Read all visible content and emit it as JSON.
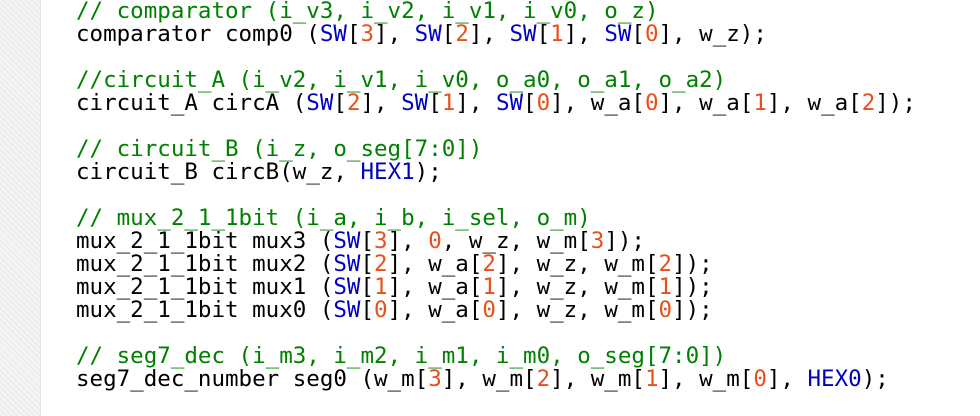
{
  "code_lines": [
    [
      {
        "t": "// comparator (i_v3, i_v2, i_v1, i_v0, o_z)",
        "k": "c"
      }
    ],
    [
      {
        "t": "comparator comp0 (",
        "k": "d"
      },
      {
        "t": "SW",
        "k": "sw"
      },
      {
        "t": "[",
        "k": "d"
      },
      {
        "t": "3",
        "k": "n"
      },
      {
        "t": "], ",
        "k": "d"
      },
      {
        "t": "SW",
        "k": "sw"
      },
      {
        "t": "[",
        "k": "d"
      },
      {
        "t": "2",
        "k": "n"
      },
      {
        "t": "], ",
        "k": "d"
      },
      {
        "t": "SW",
        "k": "sw"
      },
      {
        "t": "[",
        "k": "d"
      },
      {
        "t": "1",
        "k": "n"
      },
      {
        "t": "], ",
        "k": "d"
      },
      {
        "t": "SW",
        "k": "sw"
      },
      {
        "t": "[",
        "k": "d"
      },
      {
        "t": "0",
        "k": "n"
      },
      {
        "t": "], w_z);",
        "k": "d"
      }
    ],
    [],
    [
      {
        "t": "//circuit_A (i_v2, i_v1, i_v0, o_a0, o_a1, o_a2)",
        "k": "c"
      }
    ],
    [
      {
        "t": "circuit_A circA (",
        "k": "d"
      },
      {
        "t": "SW",
        "k": "sw"
      },
      {
        "t": "[",
        "k": "d"
      },
      {
        "t": "2",
        "k": "n"
      },
      {
        "t": "], ",
        "k": "d"
      },
      {
        "t": "SW",
        "k": "sw"
      },
      {
        "t": "[",
        "k": "d"
      },
      {
        "t": "1",
        "k": "n"
      },
      {
        "t": "], ",
        "k": "d"
      },
      {
        "t": "SW",
        "k": "sw"
      },
      {
        "t": "[",
        "k": "d"
      },
      {
        "t": "0",
        "k": "n"
      },
      {
        "t": "], w_a[",
        "k": "d"
      },
      {
        "t": "0",
        "k": "n"
      },
      {
        "t": "], w_a[",
        "k": "d"
      },
      {
        "t": "1",
        "k": "n"
      },
      {
        "t": "], w_a[",
        "k": "d"
      },
      {
        "t": "2",
        "k": "n"
      },
      {
        "t": "]);",
        "k": "d"
      }
    ],
    [],
    [
      {
        "t": "// circuit_B (i_z, o_seg[7:0])",
        "k": "c"
      }
    ],
    [
      {
        "t": "circuit_B circB(w_z, ",
        "k": "d"
      },
      {
        "t": "HEX1",
        "k": "hex"
      },
      {
        "t": ");",
        "k": "d"
      }
    ],
    [],
    [
      {
        "t": "// mux_2_1_1bit (i_a, i_b, i_sel, o_m)",
        "k": "c"
      }
    ],
    [
      {
        "t": "mux_2_1_1bit mux3 (",
        "k": "d"
      },
      {
        "t": "SW",
        "k": "sw"
      },
      {
        "t": "[",
        "k": "d"
      },
      {
        "t": "3",
        "k": "n"
      },
      {
        "t": "], ",
        "k": "d"
      },
      {
        "t": "0",
        "k": "n"
      },
      {
        "t": ", w_z, w_m[",
        "k": "d"
      },
      {
        "t": "3",
        "k": "n"
      },
      {
        "t": "]);",
        "k": "d"
      }
    ],
    [
      {
        "t": "mux_2_1_1bit mux2 (",
        "k": "d"
      },
      {
        "t": "SW",
        "k": "sw"
      },
      {
        "t": "[",
        "k": "d"
      },
      {
        "t": "2",
        "k": "n"
      },
      {
        "t": "], w_a[",
        "k": "d"
      },
      {
        "t": "2",
        "k": "n"
      },
      {
        "t": "], w_z, w_m[",
        "k": "d"
      },
      {
        "t": "2",
        "k": "n"
      },
      {
        "t": "]);",
        "k": "d"
      }
    ],
    [
      {
        "t": "mux_2_1_1bit mux1 (",
        "k": "d"
      },
      {
        "t": "SW",
        "k": "sw"
      },
      {
        "t": "[",
        "k": "d"
      },
      {
        "t": "1",
        "k": "n"
      },
      {
        "t": "], w_a[",
        "k": "d"
      },
      {
        "t": "1",
        "k": "n"
      },
      {
        "t": "], w_z, w_m[",
        "k": "d"
      },
      {
        "t": "1",
        "k": "n"
      },
      {
        "t": "]);",
        "k": "d"
      }
    ],
    [
      {
        "t": "mux_2_1_1bit mux0 (",
        "k": "d"
      },
      {
        "t": "SW",
        "k": "sw"
      },
      {
        "t": "[",
        "k": "d"
      },
      {
        "t": "0",
        "k": "n"
      },
      {
        "t": "], w_a[",
        "k": "d"
      },
      {
        "t": "0",
        "k": "n"
      },
      {
        "t": "], w_z, w_m[",
        "k": "d"
      },
      {
        "t": "0",
        "k": "n"
      },
      {
        "t": "]);",
        "k": "d"
      }
    ],
    [],
    [
      {
        "t": "// seg7_dec (i_m3, i_m2, i_m1, i_m0, o_seg[7:0])",
        "k": "c"
      }
    ],
    [
      {
        "t": "seg7_dec_number seg0 (w_m[",
        "k": "d"
      },
      {
        "t": "3",
        "k": "n"
      },
      {
        "t": "], w_m[",
        "k": "d"
      },
      {
        "t": "2",
        "k": "n"
      },
      {
        "t": "], w_m[",
        "k": "d"
      },
      {
        "t": "1",
        "k": "n"
      },
      {
        "t": "], w_m[",
        "k": "d"
      },
      {
        "t": "0",
        "k": "n"
      },
      {
        "t": "], ",
        "k": "d"
      },
      {
        "t": "HEX0",
        "k": "hex"
      },
      {
        "t": ");",
        "k": "d"
      }
    ]
  ],
  "colors": {
    "comment": "#008000",
    "identifier_sw": "#0000c0",
    "identifier_hex": "#0000c0",
    "number": "#e8501a",
    "default": "#000000",
    "gutter": "#f4f4f4"
  }
}
